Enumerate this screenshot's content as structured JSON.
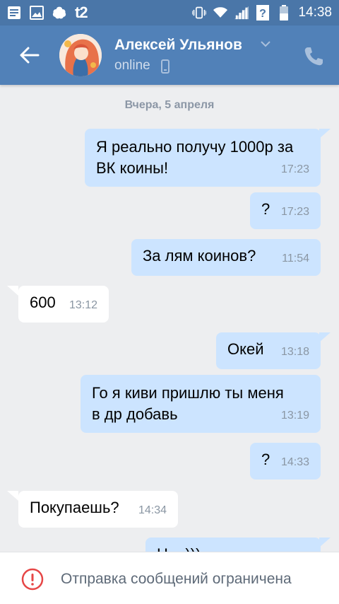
{
  "status_bar": {
    "carrier": "t2",
    "time": "14:38",
    "icons": [
      "notes-icon",
      "image-icon",
      "cloud-icon",
      "vibrate-icon",
      "wifi-icon",
      "signal-icon",
      "unknown-network-icon",
      "battery-icon"
    ]
  },
  "header": {
    "contact_name": "Алексей Ульянов",
    "status": "online",
    "icons": [
      "back-arrow-icon",
      "chevron-down-icon",
      "mobile-icon",
      "phone-icon"
    ]
  },
  "chat": {
    "date": "Вчера, 5 апреля",
    "messages": [
      {
        "dir": "out",
        "lines": [
          "Я реально получу 1000р за",
          "ВК коины!"
        ],
        "time": "17:23"
      },
      {
        "dir": "out",
        "lines": [
          "?"
        ],
        "time": "17:23"
      },
      {
        "dir": "out",
        "lines": [
          "За лям коинов?"
        ],
        "time": "11:54"
      },
      {
        "dir": "in",
        "lines": [
          "600"
        ],
        "time": "13:12"
      },
      {
        "dir": "out",
        "lines": [
          "Окей"
        ],
        "time": "13:18"
      },
      {
        "dir": "out",
        "lines": [
          "Го я киви пришлю ты меня",
          "в др добавь"
        ],
        "time": "13:19"
      },
      {
        "dir": "out",
        "lines": [
          "?"
        ],
        "time": "14:33"
      },
      {
        "dir": "in",
        "lines": [
          "Покупаешь?"
        ],
        "time": "14:34"
      },
      {
        "dir": "out",
        "lines": [
          "Н... )))"
        ],
        "time": ""
      }
    ]
  },
  "bottom_bar": {
    "message": "Отправка сообщений ограничена",
    "icon": "warning-icon"
  },
  "colors": {
    "status_bar": "#4a76a8",
    "header": "#5181b8",
    "background": "#edeef0",
    "outgoing_bubble": "#cce4ff",
    "incoming_bubble": "#ffffff",
    "warning": "#e64646"
  }
}
